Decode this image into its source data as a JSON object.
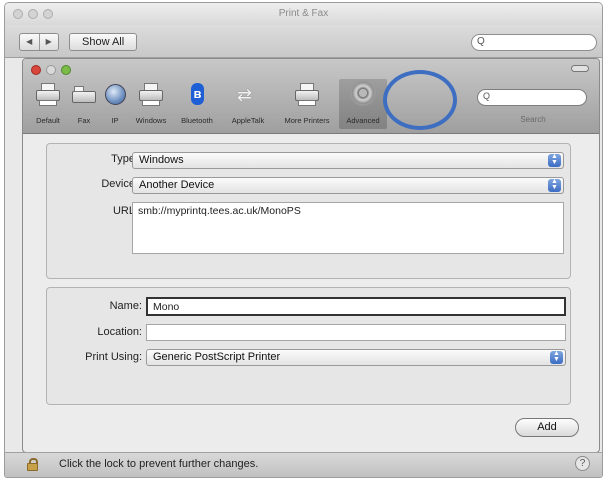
{
  "window": {
    "title": "Print & Fax"
  },
  "toolbar": {
    "show_all": "Show All",
    "back": "◀",
    "forward": "▶"
  },
  "add_printer": {
    "tools": [
      {
        "id": "default",
        "label": "Default"
      },
      {
        "id": "fax",
        "label": "Fax"
      },
      {
        "id": "ip",
        "label": "IP"
      },
      {
        "id": "windows",
        "label": "Windows"
      },
      {
        "id": "bluetooth",
        "label": "Bluetooth"
      },
      {
        "id": "appletalk",
        "label": "AppleTalk"
      },
      {
        "id": "more-printers",
        "label": "More Printers"
      },
      {
        "id": "advanced",
        "label": "Advanced",
        "selected": true
      }
    ],
    "search_label": "Search",
    "connection": {
      "type_label": "Type:",
      "type_value": "Windows",
      "device_label": "Device:",
      "device_value": "Another Device",
      "url_label": "URL:",
      "url_value": "smb://myprintq.tees.ac.uk/MonoPS"
    },
    "details": {
      "name_label": "Name:",
      "name_value": "Mono",
      "location_label": "Location:",
      "location_value": "",
      "print_using_label": "Print Using:",
      "print_using_value": "Generic PostScript Printer"
    },
    "add_button": "Add"
  },
  "status": {
    "lock_text": "Click the lock to prevent further changes.",
    "help": "?"
  },
  "colors": {
    "highlight_ring": "#3d6ec1",
    "popup_arrow": "#3b6cc4",
    "bluetooth": "#1e5fd6"
  }
}
